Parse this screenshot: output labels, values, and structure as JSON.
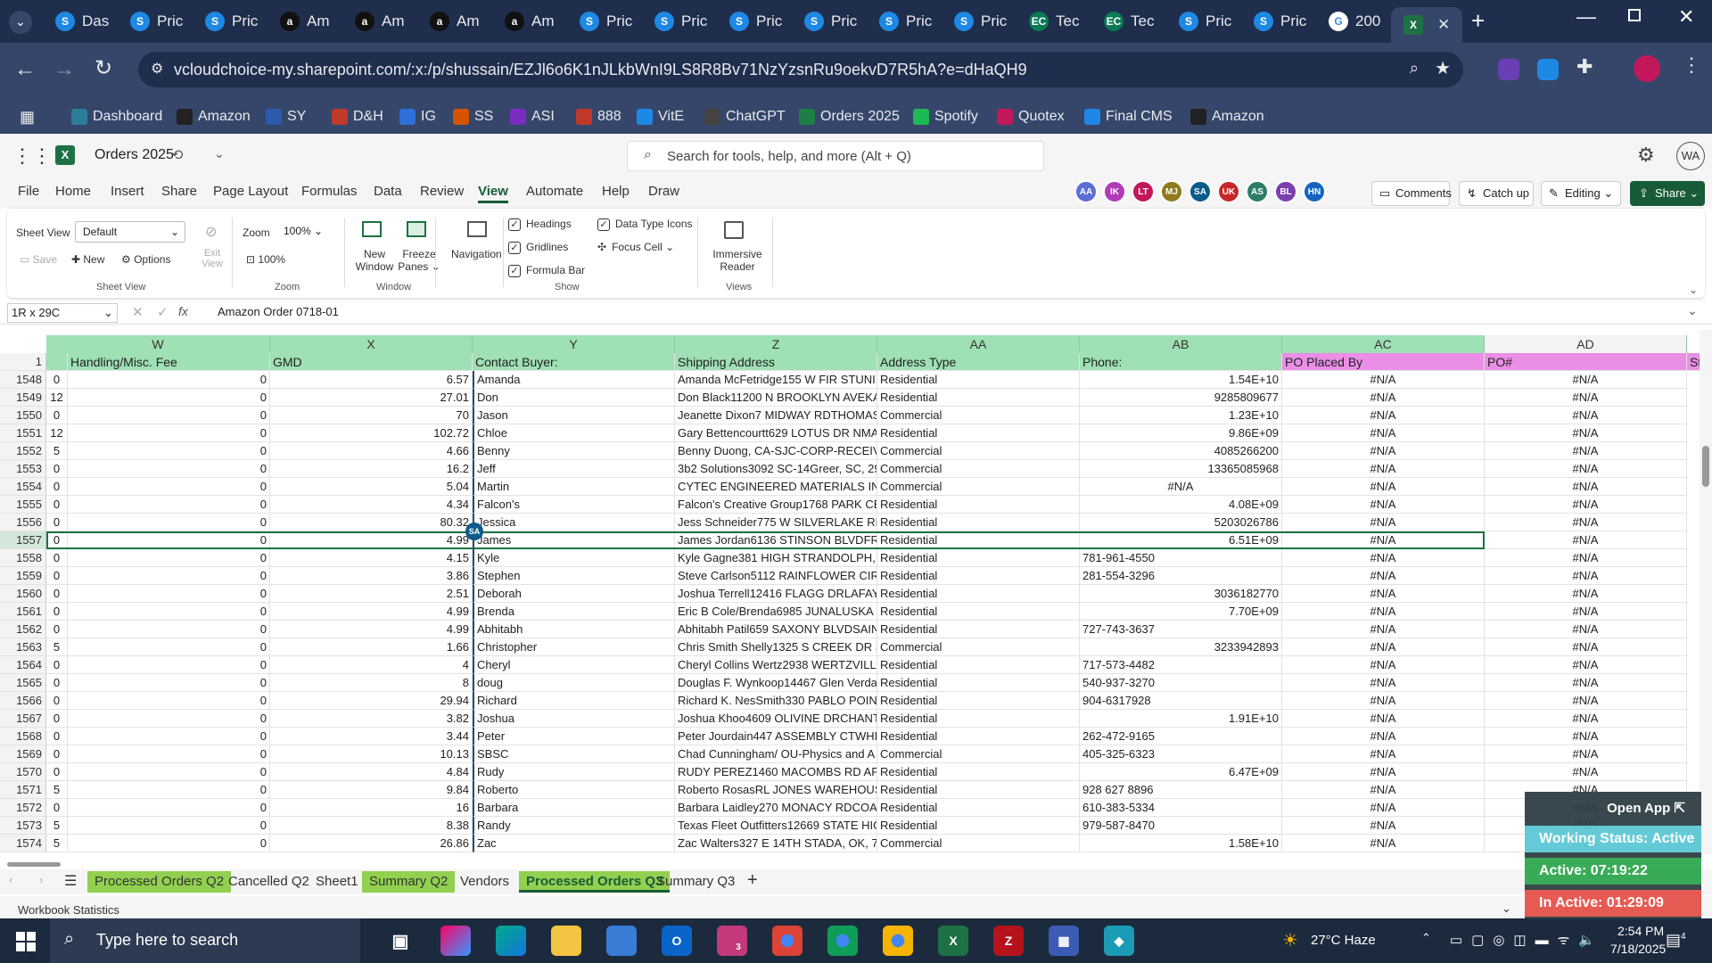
{
  "browser": {
    "tabs": [
      {
        "label": "Das",
        "icon": "s-icon"
      },
      {
        "label": "Pric",
        "icon": "s-icon"
      },
      {
        "label": "Pric",
        "icon": "s-icon"
      },
      {
        "label": "Am",
        "icon": "amazon-icon"
      },
      {
        "label": "Am",
        "icon": "amazon-icon"
      },
      {
        "label": "Am",
        "icon": "amazon-icon"
      },
      {
        "label": "Am",
        "icon": "amazon-icon"
      },
      {
        "label": "Pric",
        "icon": "s-icon"
      },
      {
        "label": "Pric",
        "icon": "s-icon"
      },
      {
        "label": "Pric",
        "icon": "s-icon"
      },
      {
        "label": "Pric",
        "icon": "s-icon"
      },
      {
        "label": "Pric",
        "icon": "s-icon"
      },
      {
        "label": "Pric",
        "icon": "s-icon"
      },
      {
        "label": "Tec",
        "icon": "ec-icon"
      },
      {
        "label": "Tec",
        "icon": "ec-icon"
      },
      {
        "label": "Pric",
        "icon": "s-icon"
      },
      {
        "label": "Pric",
        "icon": "s-icon"
      },
      {
        "label": "200",
        "icon": "google-icon"
      }
    ],
    "url": "vcloudchoice-my.sharepoint.com/:x:/p/shussain/EZJl6o6K1nJLkbWnI9LS8R8Bv71NzYzsnRu9oekvD7R5hA?e=dHaQH9",
    "bookmarks": [
      {
        "label": "Dashboard",
        "color": "#2d7d9a"
      },
      {
        "label": "Amazon",
        "color": "#222"
      },
      {
        "label": "SY",
        "color": "#2b5cab"
      },
      {
        "label": "D&H",
        "color": "#c0392b"
      },
      {
        "label": "IG",
        "color": "#2e6fd8"
      },
      {
        "label": "SS",
        "color": "#d35400"
      },
      {
        "label": "ASI",
        "color": "#7b2cbf"
      },
      {
        "label": "888",
        "color": "#c0392b"
      },
      {
        "label": "VitE",
        "color": "#1e88e5"
      },
      {
        "label": "ChatGPT",
        "color": "#444"
      },
      {
        "label": "Orders 2025",
        "color": "#1e7e45"
      },
      {
        "label": "Spotify",
        "color": "#1db954"
      },
      {
        "label": "Quotex",
        "color": "#c2185b"
      },
      {
        "label": "Final CMS",
        "color": "#1e88e5"
      },
      {
        "label": "Amazon",
        "color": "#222"
      }
    ]
  },
  "app": {
    "file_name": "Orders 2025",
    "search_placeholder": "Search for tools, help, and more (Alt + Q)",
    "user_initials": "WA",
    "menus": [
      "File",
      "Home",
      "Insert",
      "Share",
      "Page Layout",
      "Formulas",
      "Data",
      "Review",
      "View",
      "Automate",
      "Help",
      "Draw"
    ],
    "active_menu": "View",
    "collaborators": [
      {
        "initials": "AA",
        "color": "#5b6fd6"
      },
      {
        "initials": "IK",
        "color": "#b03ab8"
      },
      {
        "initials": "LT",
        "color": "#c2185b"
      },
      {
        "initials": "MJ",
        "color": "#8d7b1c"
      },
      {
        "initials": "SA",
        "color": "#0b5c8a"
      },
      {
        "initials": "UK",
        "color": "#c62828"
      },
      {
        "initials": "AS",
        "color": "#2e7d6b"
      },
      {
        "initials": "BL",
        "color": "#7b3fb0"
      },
      {
        "initials": "HN",
        "color": "#1565c0"
      }
    ],
    "comments_label": "Comments",
    "catchup_label": "Catch up",
    "editing_label": "Editing",
    "share_label": "Share"
  },
  "ribbon": {
    "sheet_view_label": "Sheet View",
    "sheet_view_value": "Default",
    "save_label": "Save",
    "new_label": "New",
    "options_label": "Options",
    "exit_view_label": "Exit\nView",
    "sheet_view_group": "Sheet View",
    "zoom_label": "Zoom",
    "zoom_value": "100%",
    "zoom_100": "100%",
    "zoom_group": "Zoom",
    "new_window": "New Window",
    "freeze_panes": "Freeze Panes",
    "window_group": "Window",
    "navigation": "Navigation",
    "headings": "Headings",
    "gridlines": "Gridlines",
    "formula_bar": "Formula Bar",
    "data_type_icons": "Data Type Icons",
    "focus_cell": "Focus Cell",
    "show_group": "Show",
    "immersive_reader": "Immersive Reader",
    "views_group": "Views"
  },
  "formula": {
    "name_box": "1R x 29C",
    "fx": "fx",
    "value": "Amazon Order 0718-01"
  },
  "columns": [
    "W",
    "X",
    "Y",
    "Z",
    "AA",
    "AB",
    "AC",
    "AD"
  ],
  "header_row": {
    "num": "1",
    "cells": [
      "Handling/Misc. Fee",
      "GMD",
      "Contact Buyer:",
      "Shipping Address",
      "Address Type",
      "Phone:",
      "PO Placed By",
      "PO#",
      "St"
    ]
  },
  "rows": [
    {
      "num": "1548",
      "v": "0",
      "w": "0",
      "x": "6.57",
      "y": "Amanda",
      "z": "Amanda McFetridge155 W FIR STUNI",
      "aa": "Residential",
      "ab": "1.54E+10",
      "abl": false,
      "ac": "#N/A",
      "ad": "#N/A"
    },
    {
      "num": "1549",
      "v": "12",
      "w": "0",
      "x": "27.01",
      "y": "Don",
      "z": "Don Black11200 N BROOKLYN AVEKA",
      "aa": "Residential",
      "ab": "9285809677",
      "abl": false,
      "ac": "#N/A",
      "ad": "#N/A"
    },
    {
      "num": "1550",
      "v": "0",
      "w": "0",
      "x": "70",
      "y": "Jason",
      "z": "Jeanette Dixon7 MIDWAY RDTHOMAS",
      "aa": "Commercial",
      "ab": "1.23E+10",
      "abl": false,
      "ac": "#N/A",
      "ad": "#N/A"
    },
    {
      "num": "1551",
      "v": "12",
      "w": "0",
      "x": "102.72",
      "y": "Chloe",
      "z": "Gary Bettencourtt629 LOTUS DR NMA",
      "aa": "Residential",
      "ab": "9.86E+09",
      "abl": false,
      "ac": "#N/A",
      "ad": "#N/A"
    },
    {
      "num": "1552",
      "v": "5",
      "w": "0",
      "x": "4.66",
      "y": "Benny",
      "z": "Benny Duong, CA-SJC-CORP-RECEIVIN",
      "aa": "Commercial",
      "ab": "4085266200",
      "abl": false,
      "ac": "#N/A",
      "ad": "#N/A"
    },
    {
      "num": "1553",
      "v": "0",
      "w": "0",
      "x": "16.2",
      "y": "Jeff",
      "z": "3b2 Solutions3092 SC-14Greer, SC, 29",
      "aa": "Commercial",
      "ab": "13365085968",
      "abl": false,
      "ac": "#N/A",
      "ad": "#N/A"
    },
    {
      "num": "1554",
      "v": "0",
      "w": "0",
      "x": "5.04",
      "y": "Martin",
      "z": "CYTEC ENGINEERED MATERIALS INC.1",
      "aa": "Commercial",
      "ab": "#N/A",
      "abl": "center",
      "ac": "#N/A",
      "ad": "#N/A"
    },
    {
      "num": "1555",
      "v": "0",
      "w": "0",
      "x": "4.34",
      "y": "Falcon's",
      "z": "Falcon's Creative Group1768 PARK CE",
      "aa": "Residential",
      "ab": "4.08E+09",
      "abl": false,
      "ac": "#N/A",
      "ad": "#N/A"
    },
    {
      "num": "1556",
      "v": "0",
      "w": "0",
      "x": "80.32",
      "y": "Jessica",
      "z": "Jess Schneider775 W SILVERLAKE RDT",
      "aa": "Residential",
      "ab": "5203026786",
      "abl": false,
      "ac": "#N/A",
      "ad": "#N/A"
    },
    {
      "num": "1557",
      "v": "0",
      "w": "0",
      "x": "4.99",
      "y": "James",
      "z": "James Jordan6136 STINSON BLVDFRID",
      "aa": "Residential",
      "ab": "6.51E+09",
      "abl": false,
      "ac": "#N/A",
      "ad": "#N/A"
    },
    {
      "num": "1558",
      "v": "0",
      "w": "0",
      "x": "4.15",
      "y": "Kyle",
      "z": "Kyle Gagne381 HIGH STRANDOLPH, M",
      "aa": "Residential",
      "ab": "781-961-4550",
      "abl": true,
      "ac": "#N/A",
      "ad": "#N/A"
    },
    {
      "num": "1559",
      "v": "0",
      "w": "0",
      "x": "3.86",
      "y": "Stephen",
      "z": "Steve Carlson5112 RAINFLOWER CIR S",
      "aa": "Residential",
      "ab": "281-554-3296",
      "abl": true,
      "ac": "#N/A",
      "ad": "#N/A"
    },
    {
      "num": "1560",
      "v": "0",
      "w": "0",
      "x": "2.51",
      "y": "Deborah",
      "z": "Joshua Terrell12416 FLAGG DRLAFAYE",
      "aa": "Residential",
      "ab": "3036182770",
      "abl": false,
      "ac": "#N/A",
      "ad": "#N/A"
    },
    {
      "num": "1561",
      "v": "0",
      "w": "0",
      "x": "4.99",
      "y": "Brenda",
      "z": "Eric B Cole/Brenda6985 JUNALUSKA R",
      "aa": "Residential",
      "ab": "7.70E+09",
      "abl": false,
      "ac": "#N/A",
      "ad": "#N/A"
    },
    {
      "num": "1562",
      "v": "0",
      "w": "0",
      "x": "4.99",
      "y": "Abhitabh",
      "z": "Abhitabh Patil659 SAXONY BLVDSAINT",
      "aa": "Residential",
      "ab": "727-743-3637",
      "abl": true,
      "ac": "#N/A",
      "ad": "#N/A"
    },
    {
      "num": "1563",
      "v": "5",
      "w": "0",
      "x": "1.66",
      "y": "Christopher",
      "z": "Chris Smith Shelly1325 S CREEK DR ST",
      "aa": "Commercial",
      "ab": "3233942893",
      "abl": false,
      "ac": "#N/A",
      "ad": "#N/A"
    },
    {
      "num": "1564",
      "v": "0",
      "w": "0",
      "x": "4",
      "y": "Cheryl",
      "z": "Cheryl Collins Wertz2938 WERTZVILLE",
      "aa": "Residential",
      "ab": "717-573-4482",
      "abl": true,
      "ac": "#N/A",
      "ad": "#N/A"
    },
    {
      "num": "1565",
      "v": "0",
      "w": "0",
      "x": "8",
      "y": "doug",
      "z": "Douglas F. Wynkoop14467 Glen Verda",
      "aa": "Residential",
      "ab": "540-937-3270",
      "abl": true,
      "ac": "#N/A",
      "ad": "#N/A"
    },
    {
      "num": "1566",
      "v": "0",
      "w": "0",
      "x": "29.94",
      "y": "Richard",
      "z": "Richard K. NesSmith330 PABLO POINT",
      "aa": "Residential",
      "ab": "904-6317928",
      "abl": true,
      "ac": "#N/A",
      "ad": "#N/A"
    },
    {
      "num": "1567",
      "v": "0",
      "w": "0",
      "x": "3.82",
      "y": "Joshua",
      "z": "Joshua Khoo4609 OLIVINE DRCHANTI",
      "aa": "Residential",
      "ab": "1.91E+10",
      "abl": false,
      "ac": "#N/A",
      "ad": "#N/A"
    },
    {
      "num": "1568",
      "v": "0",
      "w": "0",
      "x": "3.44",
      "y": "Peter",
      "z": "Peter Jourdain447 ASSEMBLY CTWHIT",
      "aa": "Residential",
      "ab": "262-472-9165",
      "abl": true,
      "ac": "#N/A",
      "ad": "#N/A"
    },
    {
      "num": "1569",
      "v": "0",
      "w": "0",
      "x": "10.13",
      "y": "SBSC",
      "z": "Chad Cunningham/ OU-Physics and A",
      "aa": "Commercial",
      "ab": "405-325-6323",
      "abl": true,
      "ac": "#N/A",
      "ad": "#N/A"
    },
    {
      "num": "1570",
      "v": "0",
      "w": "0",
      "x": "4.84",
      "y": "Rudy",
      "z": "RUDY PEREZ1460 MACOMBS RD APT",
      "aa": "Residential",
      "ab": "6.47E+09",
      "abl": false,
      "ac": "#N/A",
      "ad": "#N/A"
    },
    {
      "num": "1571",
      "v": "5",
      "w": "0",
      "x": "9.84",
      "y": "Roberto",
      "z": "Roberto RosasRL JONES WAREHOUSE",
      "aa": "Residential",
      "ab": "928 627 8896",
      "abl": true,
      "ac": "#N/A",
      "ad": "#N/A"
    },
    {
      "num": "1572",
      "v": "0",
      "w": "0",
      "x": "16",
      "y": "Barbara",
      "z": "Barbara Laidley270 MONACY RDCOAT",
      "aa": "Residential",
      "ab": "610-383-5334",
      "abl": true,
      "ac": "#N/A",
      "ad": "#N/A"
    },
    {
      "num": "1573",
      "v": "5",
      "w": "0",
      "x": "8.38",
      "y": "Randy",
      "z": "Texas Fleet Outfitters12669 STATE HIG",
      "aa": "Residential",
      "ab": "979-587-8470",
      "abl": true,
      "ac": "#N/A",
      "ad": "#N/A"
    },
    {
      "num": "1574",
      "v": "5",
      "w": "0",
      "x": "26.86",
      "y": "Zac",
      "z": "Zac Walters327 E 14TH STADA, OK, 74",
      "aa": "Commercial",
      "ab": "1.58E+10",
      "abl": false,
      "ac": "#N/A",
      "ad": "#N/A"
    }
  ],
  "selected_row": "1557",
  "presence_badge": "SA",
  "sheet_tabs": [
    {
      "label": "Processed Orders Q2",
      "style": "green"
    },
    {
      "label": "Cancelled Q2",
      "style": "plain"
    },
    {
      "label": "Sheet1",
      "style": "plain"
    },
    {
      "label": "Summary Q2",
      "style": "green"
    },
    {
      "label": "Vendors",
      "style": "plain"
    },
    {
      "label": "Processed Orders Q3",
      "style": "active"
    },
    {
      "label": "Summary Q3",
      "style": "plain"
    }
  ],
  "status_bar": {
    "left": "Workbook Statistics"
  },
  "widget": {
    "open_app": "Open App",
    "working_status": "Working Status: Active",
    "active": "Active: 07:19:22",
    "inactive": "In Active: 01:29:09"
  },
  "taskbar": {
    "search_placeholder": "Type here to search",
    "weather": "27°C  Haze",
    "time": "2:54 PM",
    "date": "7/18/2025",
    "notif_count": "4",
    "outlook_badge": "3"
  },
  "colors": {
    "accent": "#185c37",
    "header_green": "#9fe0b5",
    "tab_green": "#92d050",
    "selection": "#1e7145"
  }
}
